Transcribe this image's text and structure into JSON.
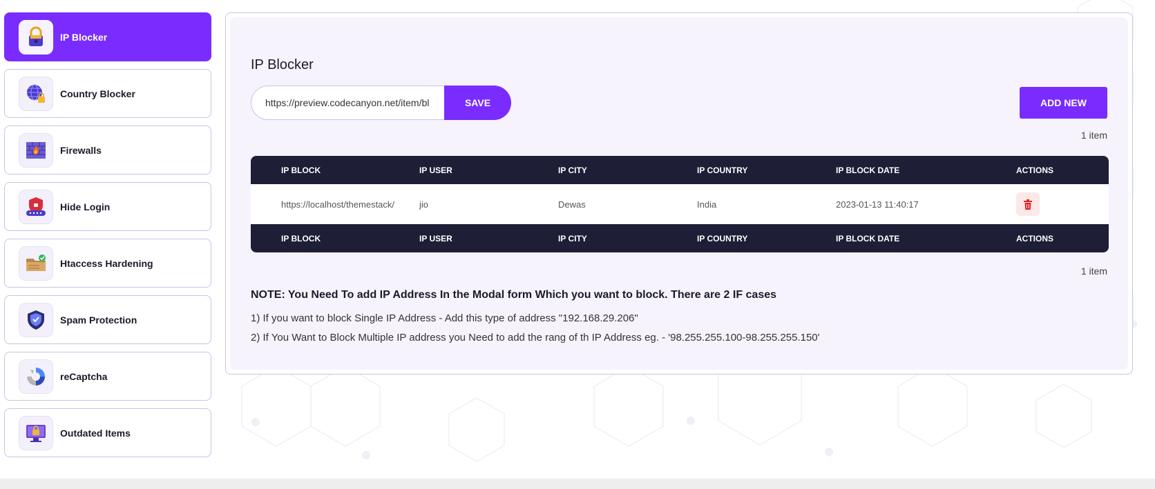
{
  "sidebar": {
    "items": [
      {
        "label": "IP Blocker",
        "icon": "lock-icon",
        "active": true
      },
      {
        "label": "Country Blocker",
        "icon": "globe-lock-icon",
        "active": false
      },
      {
        "label": "Firewalls",
        "icon": "firewall-icon",
        "active": false
      },
      {
        "label": "Hide Login",
        "icon": "shield-login-icon",
        "active": false
      },
      {
        "label": "Htaccess Hardening",
        "icon": "folder-check-icon",
        "active": false
      },
      {
        "label": "Spam Protection",
        "icon": "shield-check-icon",
        "active": false
      },
      {
        "label": "reCaptcha",
        "icon": "recaptcha-icon",
        "active": false
      },
      {
        "label": "Outdated Items",
        "icon": "monitor-lock-icon",
        "active": false
      }
    ]
  },
  "main": {
    "title": "IP Blocker",
    "url_input": {
      "value": "https://preview.codecanyon.net/item/bl"
    },
    "save_label": "SAVE",
    "add_new_label": "ADD NEW",
    "item_count": "1 item",
    "table": {
      "columns": [
        "IP BLOCK",
        "IP USER",
        "IP CITY",
        "IP COUNTRY",
        "IP BLOCK DATE",
        "ACTIONS"
      ],
      "rows": [
        [
          "https://localhost/themestack/",
          "jio",
          "Dewas",
          "India",
          "2023-01-13 11:40:17"
        ]
      ]
    },
    "note": {
      "title": "NOTE: You Need To add IP Address In the Modal form Which you want to block. There are 2 IF cases",
      "lines": [
        "1) If you want to block Single IP Address - Add this type of address \"192.168.29.206\"",
        "2) If You Want to Block Multiple IP address you Need to add the rang of th IP Address eg. - '98.255.255.100-98.255.255.150'"
      ]
    }
  },
  "colors": {
    "accent": "#7a2cff",
    "table_header": "#1e1f36",
    "panel_bg": "#f6f3fc",
    "danger": "#e02424"
  }
}
